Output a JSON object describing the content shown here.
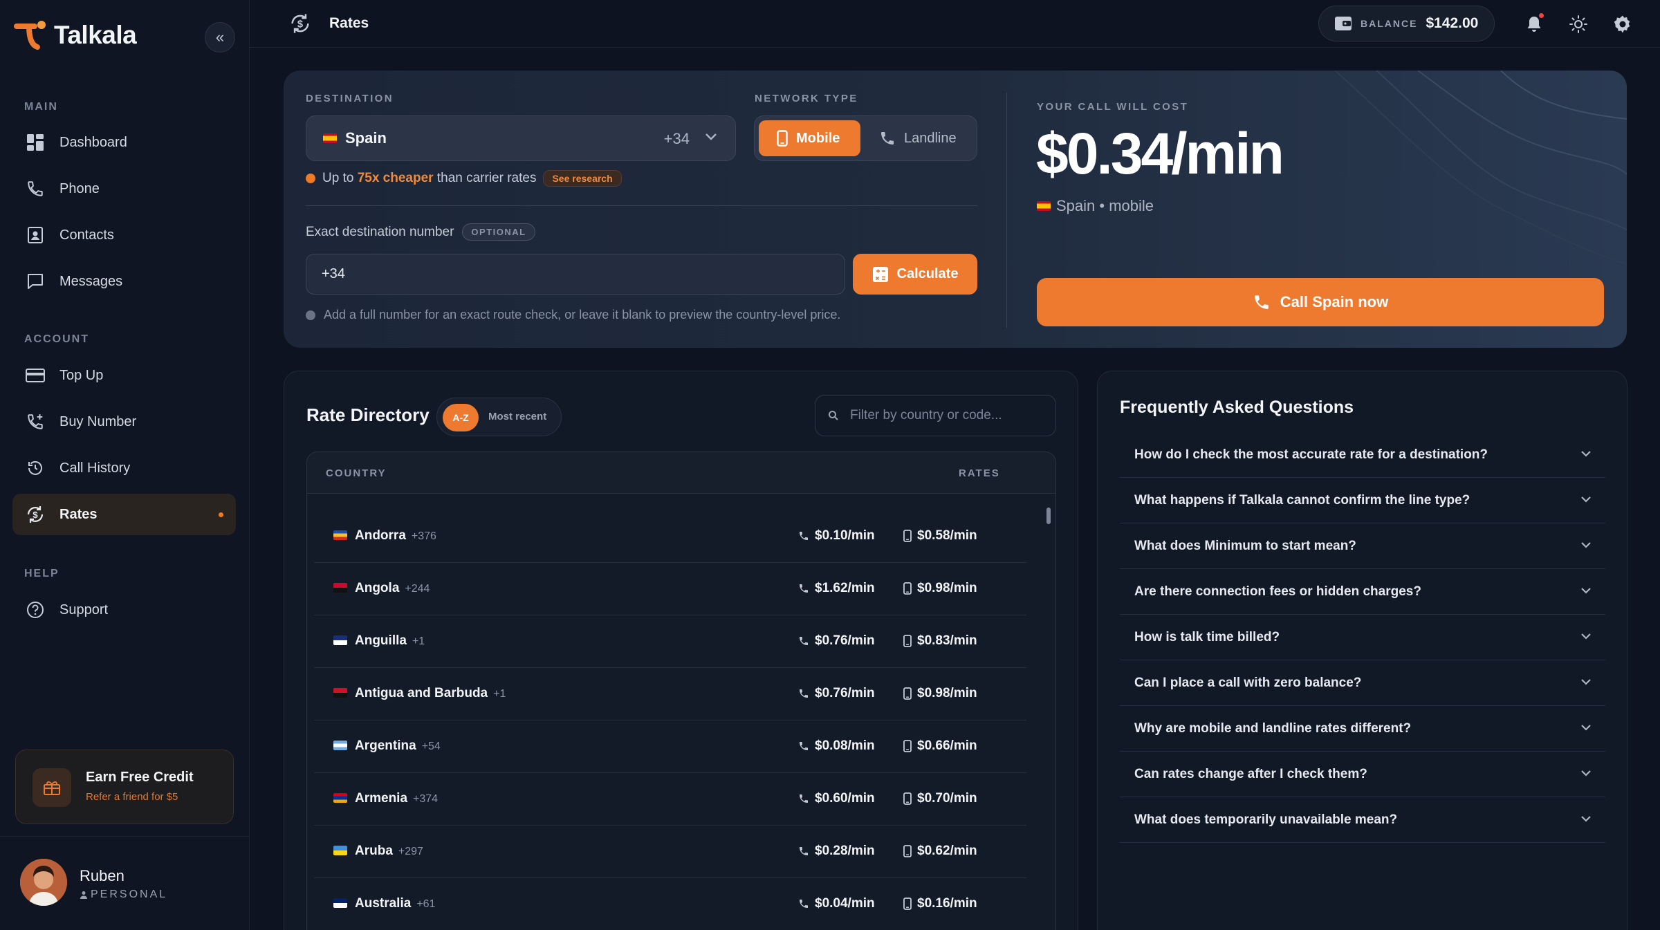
{
  "app": {
    "name": "Talkala",
    "page_title": "Rates"
  },
  "colors": {
    "accent": "#ee7a2f",
    "background": "#0d1320",
    "notification": "#ef4444"
  },
  "sidebar": {
    "sections": {
      "main": "MAIN",
      "account": "ACCOUNT",
      "help": "HELP"
    },
    "main_items": [
      {
        "label": "Dashboard",
        "icon": "dashboard-icon"
      },
      {
        "label": "Phone",
        "icon": "phone-icon"
      },
      {
        "label": "Contacts",
        "icon": "contacts-icon"
      },
      {
        "label": "Messages",
        "icon": "messages-icon"
      }
    ],
    "account_items": [
      {
        "label": "Top Up",
        "icon": "credit-card-icon"
      },
      {
        "label": "Buy Number",
        "icon": "phone-plus-icon"
      },
      {
        "label": "Call History",
        "icon": "history-icon"
      },
      {
        "label": "Rates",
        "icon": "rates-icon",
        "active": true
      }
    ],
    "help_items": [
      {
        "label": "Support",
        "icon": "help-circle-icon"
      }
    ],
    "promo": {
      "title": "Earn Free Credit",
      "subtitle": "Refer a friend for $5"
    },
    "user": {
      "name": "Ruben",
      "role": "PERSONAL"
    }
  },
  "topbar": {
    "title": "Rates",
    "balance_label": "BALANCE",
    "balance_value": "$142.00"
  },
  "calculator": {
    "destination_label": "DESTINATION",
    "destination_name": "Spain",
    "destination_code": "+34",
    "network_label": "NETWORK TYPE",
    "network_options": [
      "Mobile",
      "Landline"
    ],
    "network_selected": "Mobile",
    "cheaper_prefix": "Up to",
    "cheaper_highlight": "75x cheaper",
    "cheaper_suffix": "than carrier rates",
    "see_research": "See research",
    "exact_label": "Exact destination number",
    "optional_badge": "OPTIONAL",
    "number_value": "+34",
    "calculate_label": "Calculate",
    "hint": "Add a full number for an exact route check, or leave it blank to preview the country-level price.",
    "cost_label": "YOUR CALL WILL COST",
    "cost_value": "$0.34/min",
    "cost_subtitle": "Spain • mobile",
    "call_button": "Call Spain now"
  },
  "directory": {
    "title": "Rate Directory",
    "sort_az": "A-Z",
    "sort_recent": "Most recent",
    "filter_placeholder": "Filter by country or code...",
    "col_country": "COUNTRY",
    "col_rates": "RATES",
    "rows": [
      {
        "country": "Andorra",
        "code": "+376",
        "landline": "$0.10/min",
        "mobile": "$0.58/min",
        "flag": [
          "#1f4fa8",
          "#f2c230",
          "#d52b1e"
        ]
      },
      {
        "country": "Angola",
        "code": "+244",
        "landline": "$1.62/min",
        "mobile": "$0.98/min",
        "flag": [
          "#cc092f",
          "#111111"
        ]
      },
      {
        "country": "Anguilla",
        "code": "+1",
        "landline": "$0.76/min",
        "mobile": "$0.83/min",
        "flag": [
          "#1a2e7a",
          "#ffffff"
        ]
      },
      {
        "country": "Antigua and Barbuda",
        "code": "+1",
        "landline": "$0.76/min",
        "mobile": "$0.98/min",
        "flag": [
          "#ce1126",
          "#111111"
        ]
      },
      {
        "country": "Argentina",
        "code": "+54",
        "landline": "$0.08/min",
        "mobile": "$0.66/min",
        "flag": [
          "#74acdf",
          "#ffffff",
          "#74acdf"
        ]
      },
      {
        "country": "Armenia",
        "code": "+374",
        "landline": "$0.60/min",
        "mobile": "$0.70/min",
        "flag": [
          "#d90012",
          "#0033a0",
          "#f2a800"
        ]
      },
      {
        "country": "Aruba",
        "code": "+297",
        "landline": "$0.28/min",
        "mobile": "$0.62/min",
        "flag": [
          "#418fde",
          "#f9d616"
        ]
      },
      {
        "country": "Australia",
        "code": "+61",
        "landline": "$0.04/min",
        "mobile": "$0.16/min",
        "flag": [
          "#012169",
          "#ffffff"
        ]
      }
    ]
  },
  "faq": {
    "title": "Frequently Asked Questions",
    "items": [
      "How do I check the most accurate rate for a destination?",
      "What happens if Talkala cannot confirm the line type?",
      "What does Minimum to start mean?",
      "Are there connection fees or hidden charges?",
      "How is talk time billed?",
      "Can I place a call with zero balance?",
      "Why are mobile and landline rates different?",
      "Can rates change after I check them?",
      "What does temporarily unavailable mean?"
    ]
  }
}
